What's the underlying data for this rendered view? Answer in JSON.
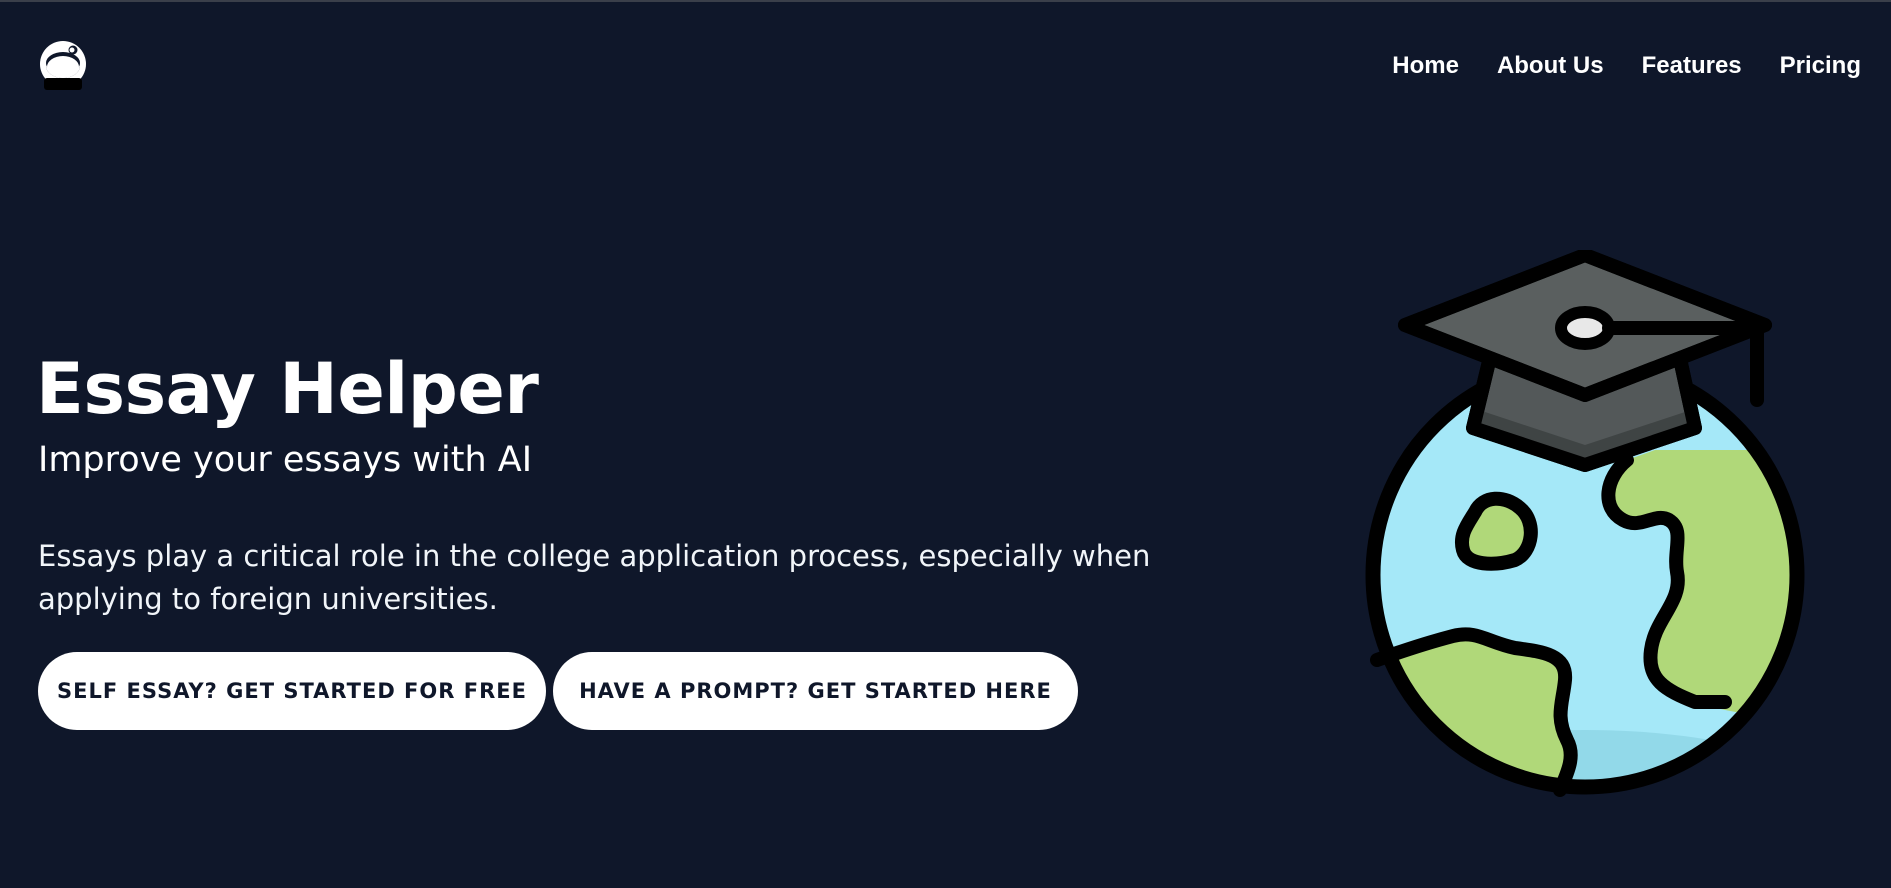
{
  "header": {
    "logo_icon": "astronaut-helmet-icon",
    "nav": [
      {
        "label": "Home"
      },
      {
        "label": "About Us"
      },
      {
        "label": "Features"
      },
      {
        "label": "Pricing"
      }
    ]
  },
  "hero": {
    "title": "Essay Helper",
    "subtitle": "Improve your essays with AI",
    "description": "Essays play a critical role in the college application process, especially when applying to foreign universities.",
    "buttons": {
      "self_essay": "SELF ESSAY? GET STARTED FOR FREE",
      "prompt": "HAVE A PROMPT? GET STARTED HERE"
    },
    "illustration_icon": "globe-with-graduation-cap-icon"
  },
  "colors": {
    "background": "#0f172a",
    "text": "#ffffff",
    "button_bg": "#ffffff",
    "button_text": "#0f172a",
    "ocean": "#a5e8f8",
    "land": "#b0d879",
    "cap": "#5a5f5f"
  }
}
